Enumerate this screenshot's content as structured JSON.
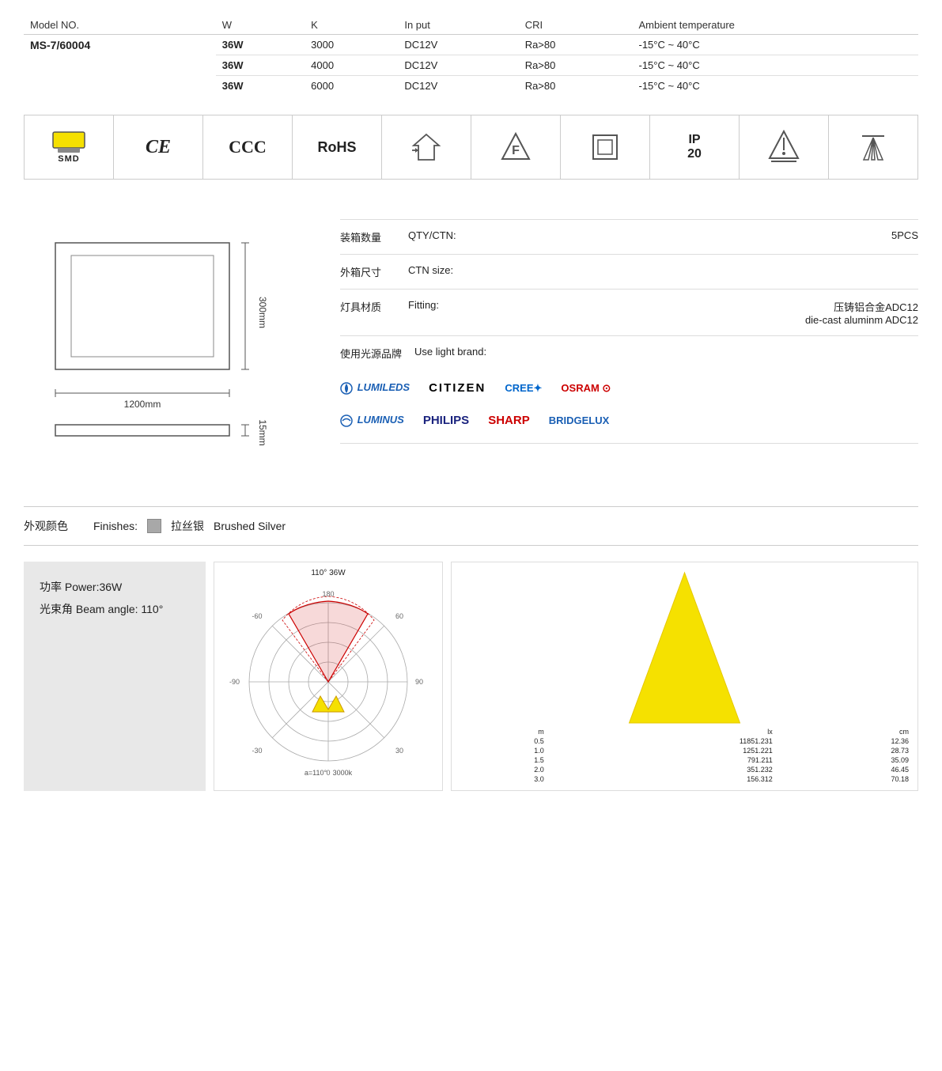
{
  "spec_table": {
    "headers": [
      "Model NO.",
      "W",
      "K",
      "In put",
      "CRI",
      "Ambient temperature"
    ],
    "model": "MS-7/60004",
    "rows": [
      {
        "w": "36W",
        "k": "3000",
        "input": "DC12V",
        "cri": "Ra>80",
        "temp": "-15°C ~ 40°C"
      },
      {
        "w": "36W",
        "k": "4000",
        "input": "DC12V",
        "cri": "Ra>80",
        "temp": "-15°C ~ 40°C"
      },
      {
        "w": "36W",
        "k": "6000",
        "input": "DC12V",
        "cri": "Ra>80",
        "temp": "-15°C ~ 40°C"
      }
    ]
  },
  "certifications": [
    {
      "name": "SMD",
      "symbol": "SMD",
      "type": "smd"
    },
    {
      "name": "CE",
      "symbol": "CE",
      "type": "ce"
    },
    {
      "name": "CCC",
      "symbol": "CCC",
      "type": "ccc"
    },
    {
      "name": "RoHS",
      "symbol": "RoHS",
      "type": "rohs"
    },
    {
      "name": "Energy",
      "symbol": "→⌂",
      "type": "energy"
    },
    {
      "name": "Flammability",
      "symbol": "▽F",
      "type": "flammability"
    },
    {
      "name": "Square",
      "symbol": "□",
      "type": "square"
    },
    {
      "name": "IP20",
      "symbol": "IP20",
      "type": "ip"
    },
    {
      "name": "WEEE",
      "symbol": "⊗",
      "type": "weee"
    },
    {
      "name": "Light",
      "symbol": "△△△",
      "type": "light"
    }
  ],
  "dimensions": {
    "width_label": "1200mm",
    "height_label": "300mm",
    "depth_label": "15mm"
  },
  "spec_info": {
    "qty_cn": "装箱数量",
    "qty_en": "QTY/CTN:",
    "qty_value": "5PCS",
    "ctn_cn": "外箱尺寸",
    "ctn_en": "CTN size:",
    "ctn_value": "",
    "fitting_cn": "灯具材质",
    "fitting_en": "Fitting:",
    "fitting_value_cn": "压铸铝合金ADC12",
    "fitting_value_en": "die-cast aluminm ADC12",
    "brand_cn": "使用光源品牌",
    "brand_en": "Use light brand:",
    "brands": [
      {
        "name": "LUMILEDS",
        "class": "brand-lumileds"
      },
      {
        "name": "CITIZEN",
        "class": "brand-citizen"
      },
      {
        "name": "CREE✦",
        "class": "brand-cree"
      },
      {
        "name": "OSRAM ⊙",
        "class": "brand-osram"
      },
      {
        "name": "LUMINUS",
        "class": "brand-luminus"
      },
      {
        "name": "PHILIPS",
        "class": "brand-philips"
      },
      {
        "name": "SHARP",
        "class": "brand-sharp"
      },
      {
        "name": "BRIDGELUX",
        "class": "brand-bridgelux"
      }
    ]
  },
  "finishes": {
    "label_cn": "外观颜色",
    "label_en": "Finishes:",
    "color_name_cn": "拉丝银",
    "color_name_en": "Brushed Silver"
  },
  "power_info": {
    "power_cn": "功率 Power:36W",
    "beam_cn": "光束角 Beam angle: 110°"
  },
  "photometric": {
    "title": "110°  36W",
    "angle_label": "a=110°",
    "temp_label": "3000k"
  },
  "lux_data": {
    "title": "",
    "rows": [
      {
        "m": "0.5",
        "lx": "11851.231",
        "cm": "12.36"
      },
      {
        "m": "1.0",
        "lx": "1251.221",
        "cm": "28.73"
      },
      {
        "m": "1.5",
        "lx": "791.211",
        "cm": "35.09"
      },
      {
        "m": "2.0",
        "lx": "351.232",
        "cm": "46.45"
      },
      {
        "m": "3.0",
        "lx": "156.312",
        "cm": "70.18"
      }
    ],
    "col_m": "m",
    "col_lx": "lx",
    "col_cm": "cm"
  }
}
